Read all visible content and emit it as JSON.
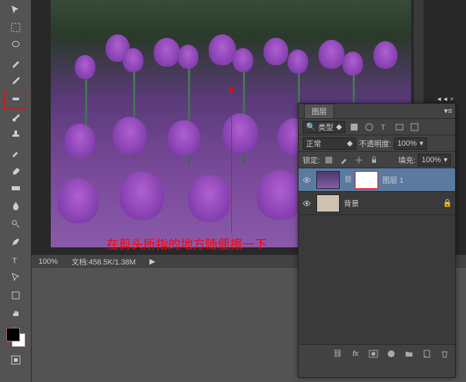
{
  "toolbar": {
    "tools": [
      "move",
      "marquee",
      "lasso",
      "magic-wand",
      "crop",
      "eyedropper",
      "healing",
      "brush",
      "stamp",
      "history-brush",
      "eraser",
      "gradient",
      "blur",
      "dodge",
      "pen",
      "type",
      "path-select",
      "rectangle",
      "hand",
      "zoom"
    ]
  },
  "canvas": {
    "zoom": "100%",
    "doc_label": "文档",
    "doc_size": ":458.5K/1.38M"
  },
  "annotation": {
    "text": "在剪头所指的地方随便擦一下"
  },
  "layers": {
    "title": "图层",
    "filter_label": "类型",
    "blend_mode": "正常",
    "opacity_label": "不透明度:",
    "opacity_value": "100%",
    "lock_label": "锁定:",
    "fill_label": "填充:",
    "fill_value": "100%",
    "items": [
      {
        "name": "图层 1",
        "selected": true,
        "has_mask": true
      },
      {
        "name": "背景",
        "selected": false,
        "has_mask": false
      }
    ]
  },
  "colors": {
    "foreground": "#000000",
    "background": "#ffffff"
  }
}
